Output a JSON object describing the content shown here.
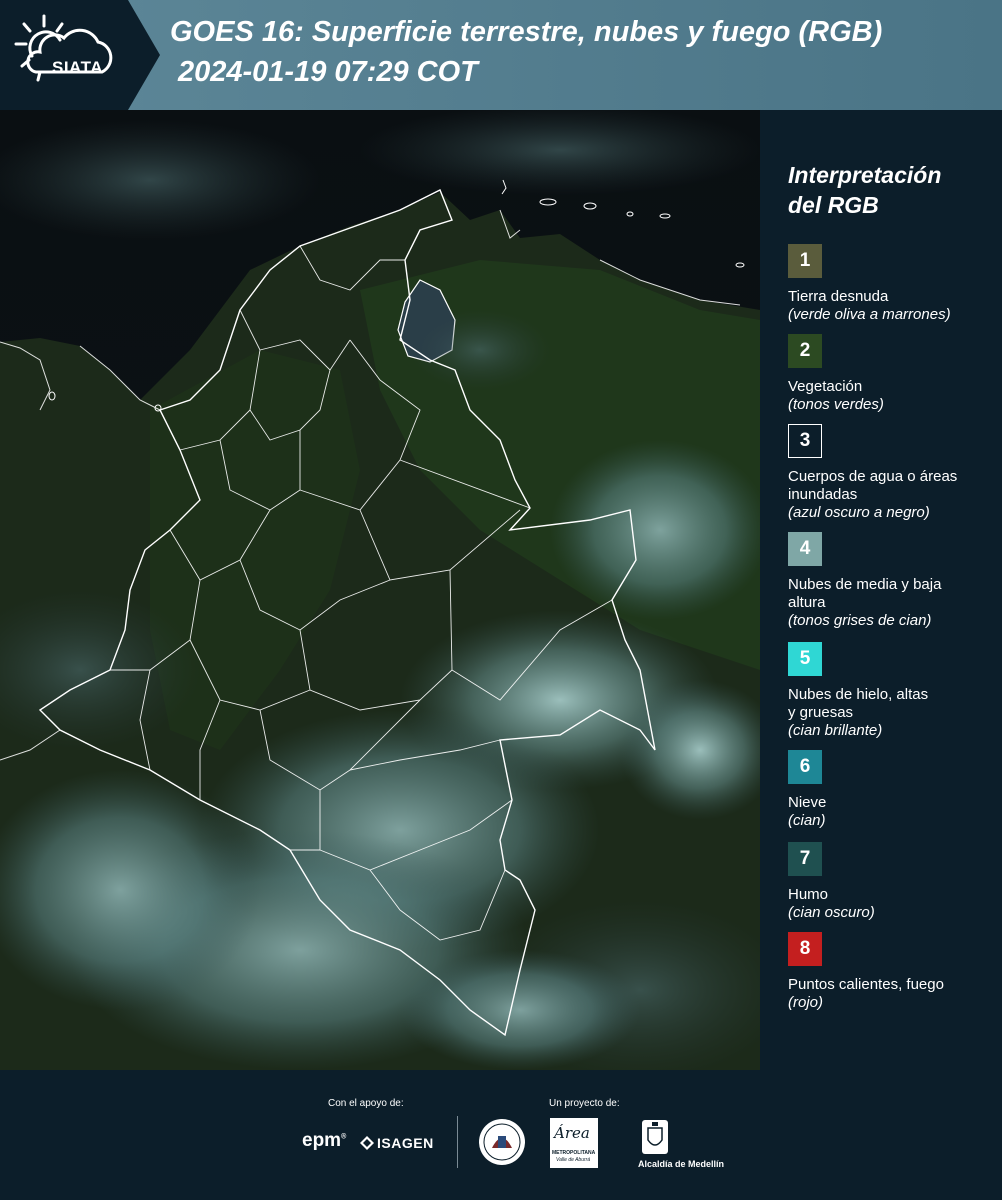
{
  "header": {
    "logo_text": "SIATA",
    "title_line1": "GOES 16: Superficie terrestre, nubes y fuego (RGB)",
    "title_line2": "2024-01-19 07:29 COT"
  },
  "legend": {
    "title_line1": "Interpretación",
    "title_line2": "del RGB",
    "items": [
      {
        "number": "1",
        "color": "#5a5c3c",
        "label": "Tierra desnuda",
        "sub": "(verde oliva a marrones)"
      },
      {
        "number": "2",
        "color": "#2c4a22",
        "label": "Vegetación",
        "sub": "(tonos verdes)"
      },
      {
        "number": "3",
        "color": "#0c1e2a",
        "label": "Cuerpos de agua o áreas inundadas",
        "sub": "(azul oscuro a negro)"
      },
      {
        "number": "4",
        "color": "#7fa7a6",
        "label": "Nubes de media y baja altura",
        "sub": "(tonos grises de cian)"
      },
      {
        "number": "5",
        "color": "#2fd7d4",
        "label": "Nubes de hielo, altas y gruesas",
        "sub": "(cian brillante)"
      },
      {
        "number": "6",
        "color": "#1e8796",
        "label": "Nieve",
        "sub": "(cian)"
      },
      {
        "number": "7",
        "color": "#1f5050",
        "label": "Humo",
        "sub": "(cian oscuro)"
      },
      {
        "number": "8",
        "color": "#c41f1f",
        "label": "Puntos calientes, fuego",
        "sub": "(rojo)"
      }
    ]
  },
  "footer": {
    "support_label": "Con el apoyo de:",
    "project_label": "Un proyecto de:",
    "epm": "epm",
    "isagen": "ISAGEN",
    "area_metro": "Área",
    "area_metro_sub": "METROPOLITANA",
    "area_metro_sub2": "Valle de Aburrá",
    "alcaldia": "Alcaldía de Medellín"
  }
}
